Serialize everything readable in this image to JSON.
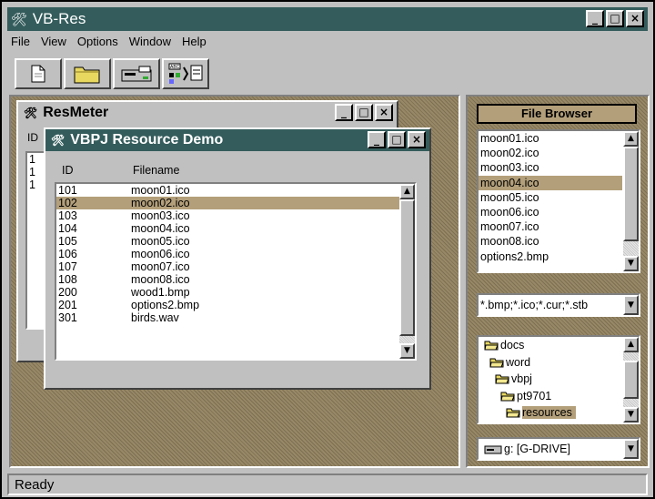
{
  "app": {
    "title": "VB-Res",
    "status": "Ready"
  },
  "menu": {
    "file": "File",
    "view": "View",
    "options": "Options",
    "window": "Window",
    "help": "Help"
  },
  "toolbar": {
    "new_icon": "new-document-icon",
    "open_icon": "open-folder-icon",
    "save_icon": "drive-icon",
    "resource_icon": "resource-compile-icon"
  },
  "resmeter": {
    "title": "ResMeter",
    "partial_header": "ID",
    "partial_rows": [
      "1",
      "1",
      "1"
    ]
  },
  "demo": {
    "title": "VBPJ Resource Demo",
    "columns": {
      "id": "ID",
      "filename": "Filename"
    },
    "rows": [
      {
        "id": "101",
        "filename": "moon01.ico"
      },
      {
        "id": "102",
        "filename": "moon02.ico"
      },
      {
        "id": "103",
        "filename": "moon03.ico"
      },
      {
        "id": "104",
        "filename": "moon04.ico"
      },
      {
        "id": "105",
        "filename": "moon05.ico"
      },
      {
        "id": "106",
        "filename": "moon06.ico"
      },
      {
        "id": "107",
        "filename": "moon07.ico"
      },
      {
        "id": "108",
        "filename": "moon08.ico"
      },
      {
        "id": "200",
        "filename": "wood1.bmp"
      },
      {
        "id": "201",
        "filename": "options2.bmp"
      },
      {
        "id": "301",
        "filename": "birds.wav"
      }
    ],
    "selected_index": 1
  },
  "filebrowser": {
    "title": "File Browser",
    "files": [
      "moon01.ico",
      "moon02.ico",
      "moon03.ico",
      "moon04.ico",
      "moon05.ico",
      "moon06.ico",
      "moon07.ico",
      "moon08.ico",
      "options2.bmp"
    ],
    "selected_index": 3,
    "filter": "*.bmp;*.ico;*.cur;*.stb",
    "dirs": [
      "docs",
      "word",
      "vbpj",
      "pt9701",
      "resources"
    ],
    "selected_dir": 4,
    "drive": "g: [G-DRIVE]"
  },
  "colors": {
    "title_bar": "#345c5c",
    "selection": "#b39f7a",
    "workspace": "#8a7a5c"
  }
}
